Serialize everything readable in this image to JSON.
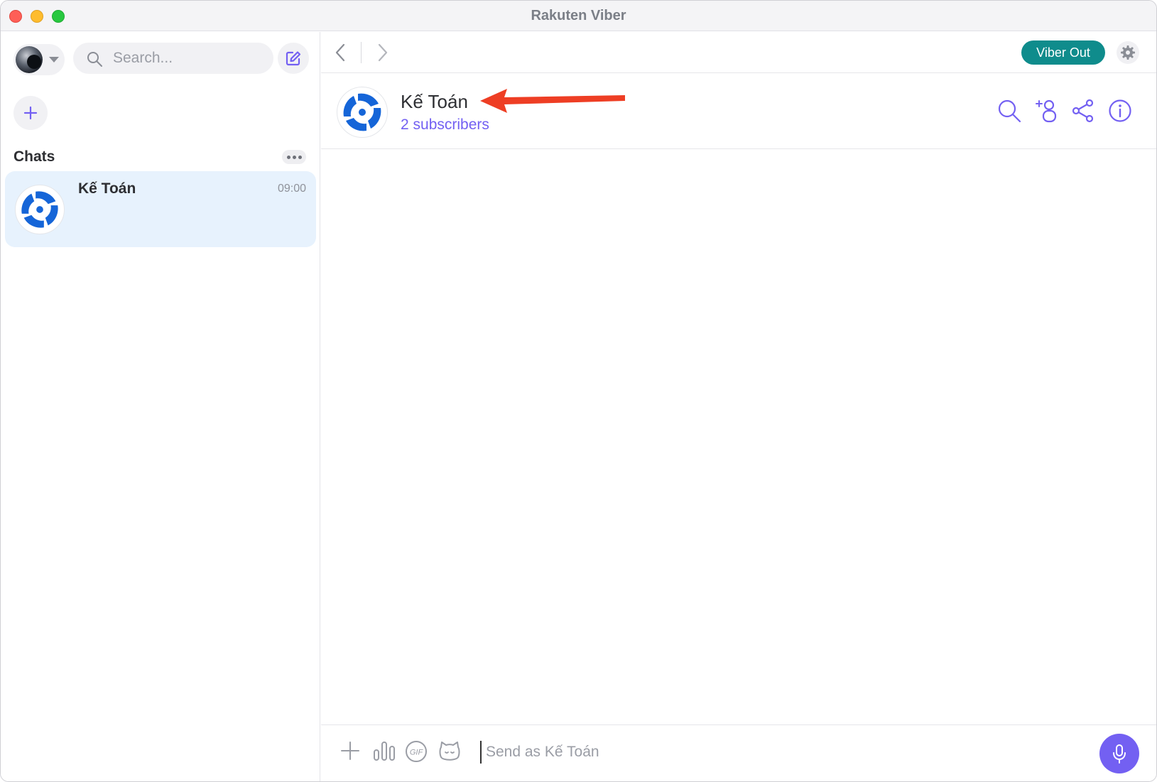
{
  "window": {
    "title": "Rakuten Viber"
  },
  "sidebar": {
    "search_placeholder": "Search...",
    "section_title": "Chats",
    "chats": [
      {
        "name": "Kế Toán",
        "time": "09:00"
      }
    ]
  },
  "topbar": {
    "viber_out_label": "Viber Out"
  },
  "chat": {
    "name": "Kế Toán",
    "subscribers": "2 subscribers"
  },
  "composer": {
    "placeholder": "Send as Kế Toán",
    "gif_label": "GIF"
  },
  "colors": {
    "accent": "#7360f2",
    "viber_out": "#0f8c8c",
    "selected_chat": "#e7f2fd",
    "logo_blue": "#1565d8",
    "annotation_arrow": "#ee3e24"
  },
  "icons": [
    "search-icon",
    "compose-icon",
    "plus-icon",
    "more-icon",
    "chevron-left-icon",
    "chevron-right-icon",
    "gear-icon",
    "add-participant-icon",
    "share-icon",
    "info-icon",
    "poll-icon",
    "gif-icon",
    "sticker-icon",
    "microphone-icon"
  ]
}
